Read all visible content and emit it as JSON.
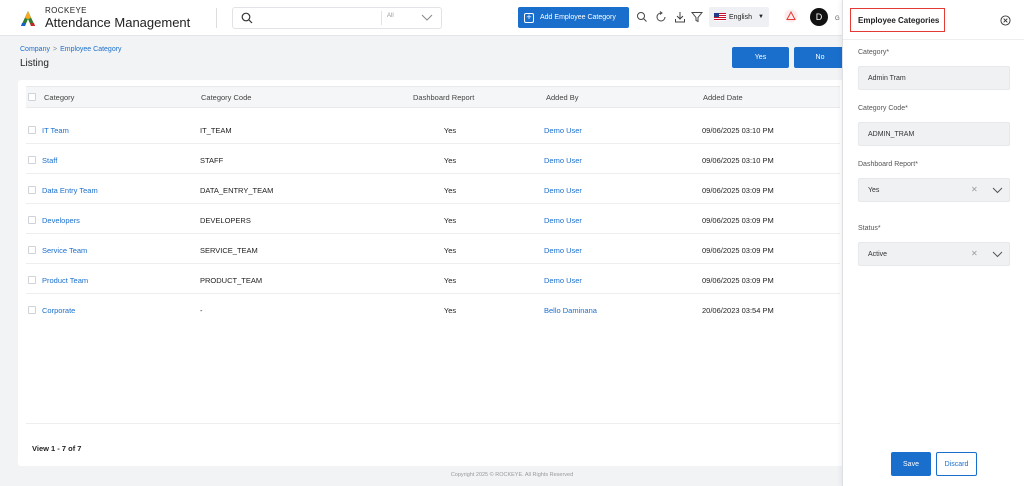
{
  "header": {
    "brand_small": "ROCKEYE",
    "brand_big": "Attendance Management",
    "search_placeholder": "",
    "search_scope": "All",
    "add_button_label": "Add Employee Category",
    "language": "English",
    "avatar_initial": "D",
    "avatar_tail": "G"
  },
  "breadcrumb": {
    "parent": "Company",
    "current": "Employee Category"
  },
  "page_title": "Listing",
  "actions": {
    "yes_label": "Yes",
    "no_label": "No"
  },
  "table": {
    "columns": [
      "Category",
      "Category Code",
      "Dashboard Report",
      "Added By",
      "Added Date"
    ],
    "rows": [
      {
        "category": "IT Team",
        "code": "IT_TEAM",
        "report": "Yes",
        "added_by": "Demo User",
        "date": "09/06/2025 03:10 PM"
      },
      {
        "category": "Staff",
        "code": "STAFF",
        "report": "Yes",
        "added_by": "Demo User",
        "date": "09/06/2025 03:10 PM"
      },
      {
        "category": "Data Entry Team",
        "code": "DATA_ENTRY_TEAM",
        "report": "Yes",
        "added_by": "Demo User",
        "date": "09/06/2025 03:09 PM"
      },
      {
        "category": "Developers",
        "code": "DEVELOPERS",
        "report": "Yes",
        "added_by": "Demo User",
        "date": "09/06/2025 03:09 PM"
      },
      {
        "category": "Service Team",
        "code": "SERVICE_TEAM",
        "report": "Yes",
        "added_by": "Demo User",
        "date": "09/06/2025 03:09 PM"
      },
      {
        "category": "Product Team",
        "code": "PRODUCT_TEAM",
        "report": "Yes",
        "added_by": "Demo User",
        "date": "09/06/2025 03:09 PM"
      },
      {
        "category": "Corporate",
        "code": "-",
        "report": "Yes",
        "added_by": "Bello Daminana",
        "date": "20/06/2023 03:54 PM"
      }
    ],
    "footer": "View 1 - 7 of 7"
  },
  "copyright": "Copyright 2025 © ROCKEYE. All Rights Reserved",
  "panel": {
    "title": "Employee Categories",
    "category_label": "Category*",
    "category_value": "Admin Tram",
    "code_label": "Category Code*",
    "code_value": "ADMIN_TRAM",
    "report_label": "Dashboard Report*",
    "report_value": "Yes",
    "status_label": "Status*",
    "status_value": "Active",
    "save_label": "Save",
    "discard_label": "Discard"
  },
  "colors": {
    "accent": "#1a6fcc",
    "highlight": "#e53935"
  },
  "icons": [
    "logo-icon",
    "search-icon",
    "chevron-down-icon",
    "plus-icon",
    "search-icon",
    "refresh-icon",
    "download-icon",
    "filter-icon",
    "flag-icon",
    "alert-icon",
    "close-icon"
  ]
}
